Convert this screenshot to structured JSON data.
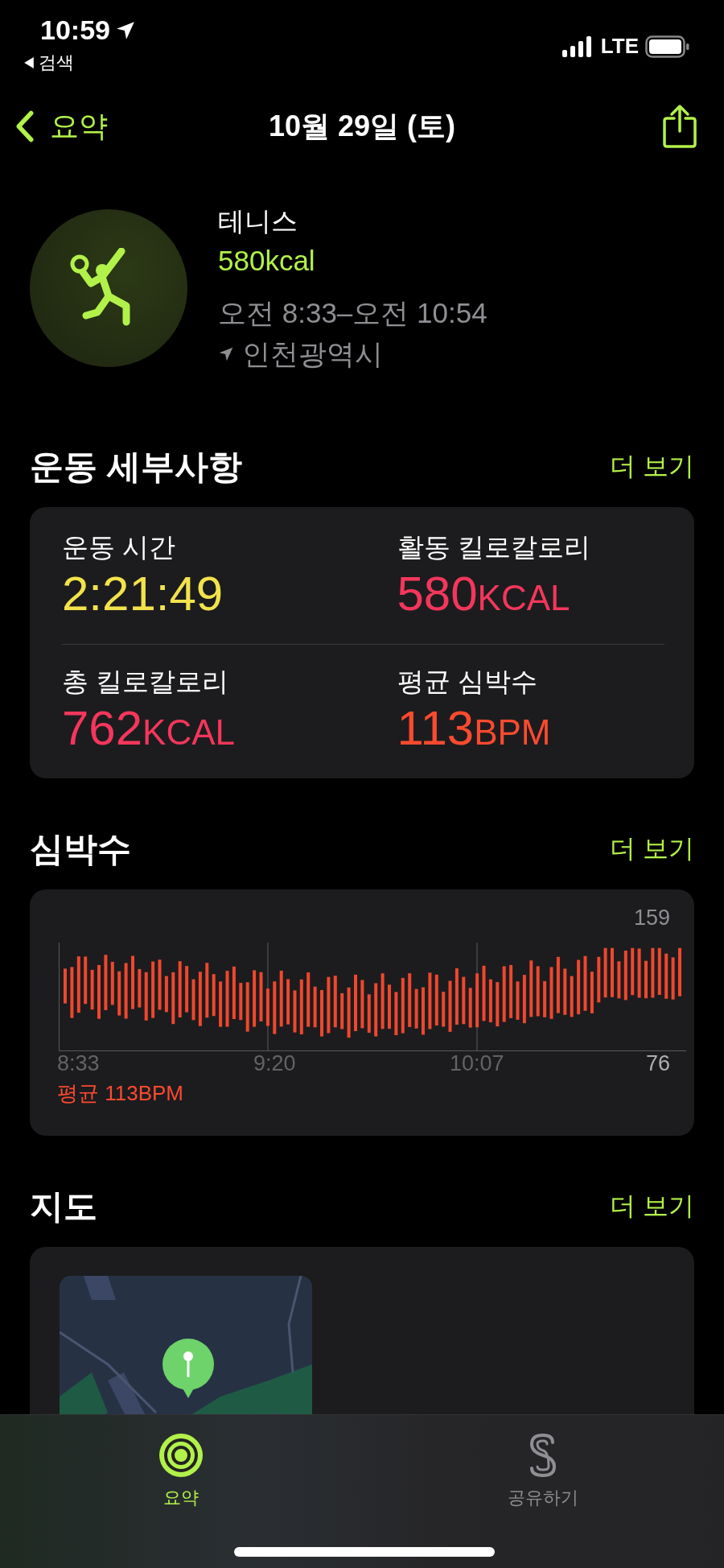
{
  "status_bar": {
    "time": "10:59",
    "back_app": "검색",
    "network": "LTE"
  },
  "nav": {
    "back": "요약",
    "title": "10월 29일 (토)"
  },
  "workout": {
    "name": "테니스",
    "calories": "580kcal",
    "time_range": "오전 8:33–오전 10:54",
    "location": "인천광역시"
  },
  "details": {
    "title": "운동 세부사항",
    "more": "더 보기",
    "metrics": [
      {
        "label": "운동 시간",
        "value": "2:21:49",
        "color": "#f2e34c"
      },
      {
        "label": "활동 킬로칼로리",
        "value": "580",
        "unit": "KCAL",
        "color": "#f5365c"
      },
      {
        "label": "총 킬로칼로리",
        "value": "762",
        "unit": "KCAL",
        "color": "#f5365c"
      },
      {
        "label": "평균 심박수",
        "value": "113",
        "unit": "BPM",
        "color": "#fc4a2f"
      }
    ]
  },
  "heart_rate": {
    "title": "심박수",
    "more": "더 보기",
    "max_label": "159",
    "min_label": "76",
    "time_labels": [
      "8:33",
      "9:20",
      "10:07"
    ],
    "average": "평균 113BPM"
  },
  "map": {
    "title": "지도",
    "more": "더 보기",
    "kind": "picture"
  },
  "tabs": [
    {
      "label": "요약",
      "kind": "summary",
      "selected": true
    },
    {
      "label": "공유하기",
      "kind": "sharing",
      "selected": false
    }
  ]
}
